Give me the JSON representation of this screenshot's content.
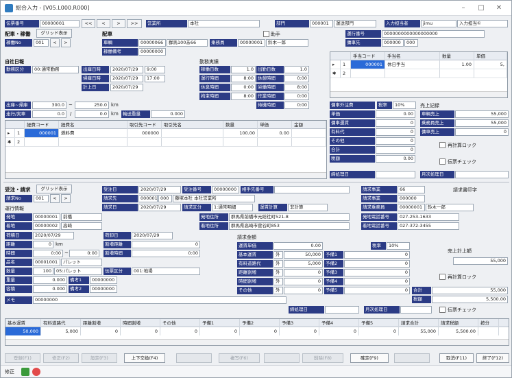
{
  "window": {
    "title": "総合入力 - [V05.L000.R000]",
    "min": "–",
    "max": "□",
    "close": "✕"
  },
  "top": {
    "denpyo_no_label": "伝票番号",
    "denpyo_no": "00000001",
    "nav": [
      "<<",
      "<",
      ">",
      ">>"
    ],
    "eigyosho_label": "営業所",
    "eigyosho_name": "本社",
    "bumon_label": "部門",
    "bumon_code": "000001",
    "bumon_name": "運送部門",
    "tanto_label": "入力担当者",
    "tanto_code": "jimu",
    "tanto_name": "入力担当①"
  },
  "haisha": {
    "title": "配車・稼働",
    "grid_btn": "グリッド表示",
    "kado_label": "稼働No",
    "kado_no": "001",
    "sharyo_title": "配車",
    "sharyo_label": "車輌",
    "sharyo_code": "00000066",
    "sharyo_name": "群馬100あ66",
    "jomu_label": "乗務員",
    "jomu_code": "00000001",
    "jomu_name": "鈴木一郎",
    "biko_label": "稼働備考",
    "biko": "00000000",
    "josho_label": "助手",
    "unko_label": "運行番号",
    "unko_no": "0000000000000000000",
    "yosha_label": "傭車先",
    "yosha_code": "000000",
    "yosha_code2": "000"
  },
  "teate": {
    "headers": [
      "手当コード",
      "手当名",
      "数量",
      "単価"
    ],
    "rows": [
      {
        "mark": "▸",
        "no": "1",
        "code": "000001",
        "name": "休日手当",
        "qty": "1.00",
        "price": "5,"
      },
      {
        "mark": "✱",
        "no": "2",
        "code": "",
        "name": "",
        "qty": "",
        "price": ""
      }
    ]
  },
  "nippo": {
    "title": "自社日報",
    "kubun_label": "勤務区分",
    "kubun": "00:通常勤務",
    "shukko_label": "出庫日時",
    "shukko_date": "2020/07/29",
    "shukko_time": "9:00",
    "kiko_label": "帰庫日時",
    "kiko_date": "2020/07/29",
    "kiko_time": "17:00",
    "keijo_label": "計上日",
    "keijo_date": "2020/07/29",
    "kinmu_title": "勤務実績",
    "rows": [
      {
        "l1": "稼働日数",
        "v1": "1.0",
        "l2": "出勤日数",
        "v2": "1.0"
      },
      {
        "l1": "運行時間",
        "v1": "8:00",
        "l2": "休憩時間",
        "v2": "0:00"
      },
      {
        "l1": "休息時間",
        "v1": "0:00",
        "l2": "労働時間",
        "v2": "8:00"
      },
      {
        "l1": "拘束時間",
        "v1": "8:00",
        "l2": "作業時間",
        "v2": "0:00"
      },
      {
        "l1": "",
        "v1": "",
        "l2": "待機時間",
        "v2": "0:00"
      }
    ],
    "meter_label": "出庫~帰庫",
    "meter_from": "300.0",
    "meter_to": "250.0",
    "meter_unit": "km",
    "sokou_label": "走行/実車",
    "sokou": "0.0",
    "jissha": "0.0",
    "jissha_unit": "km",
    "yuso_label": "輸送重量",
    "yuso": "0.000"
  },
  "keihi": {
    "headers": [
      "経費コード",
      "経費名",
      "取引先コード",
      "取引先名",
      "数量",
      "単価",
      "金額"
    ],
    "rows": [
      {
        "mark": "▸",
        "no": "1",
        "code": "000001",
        "name": "燃料費",
        "tcode": "000000",
        "tname": "",
        "qty": "100.00",
        "price": "0.00",
        "amt": ""
      },
      {
        "mark": "✱",
        "no": "2",
        "code": "",
        "name": "",
        "tcode": "",
        "tname": "",
        "qty": "",
        "price": "",
        "amt": ""
      }
    ]
  },
  "shain": {
    "label": "傭車外注費",
    "zei_label": "税率",
    "zei": "10%",
    "uriage_label": "売上記録",
    "rows": [
      {
        "l": "単価",
        "v": "0.00"
      },
      {
        "l": "傭車運賃",
        "v": "0"
      },
      {
        "l": "有料代",
        "v": "0"
      },
      {
        "l": "その他",
        "v": "0"
      },
      {
        "l": "合計",
        "v": "0"
      },
      {
        "l": "税額",
        "v": "0.00"
      }
    ],
    "urows": [
      {
        "l": "車輌売上",
        "v": "55,000"
      },
      {
        "l": "乗務員売上",
        "v": "55,000"
      },
      {
        "l": "傭車売上",
        "v": "0"
      }
    ],
    "saikei": "再計算ロック",
    "denpyo_check": "伝票チェック",
    "shime_label": "締処理日",
    "getsuji_label": "月次処理日"
  },
  "juchu": {
    "title": "受注・請求",
    "grid_btn": "グリッド表示",
    "seikyu_no_label": "請求No",
    "seikyu_no": "001",
    "juchu_date_label": "受注日",
    "juchu_date": "2020/07/29",
    "juchu_no_label": "受注番号",
    "juchu_no": "00000000",
    "aite_label": "相手先番号",
    "seikyusaki_label": "請求先",
    "seikyusaki_code": "000001",
    "seikyusaki_sub": "000",
    "seikyusaki_name": "藤塚本社 本社営業所",
    "seikyu_date_label": "請求日",
    "seikyu_date": "2020/07/29",
    "seikyu_kubun_label": "請求区分",
    "seikyu_kubun": "1:通常明細",
    "unchin_label": "運賃計算",
    "unchin": "非計算",
    "jigyo_label": "請求事業",
    "jigyo": "66",
    "jigyosho_label": "請求事業",
    "jigyosho": "000000",
    "seikyu_tanto_label": "請求乗務員",
    "seikyu_tanto_code": "00000001",
    "seikyu_tanto_name": "鈴木一郎",
    "insatsu": "請求書印字",
    "unko_title": "運行情報",
    "hatsuchi_label": "発地",
    "hatsuchi_code": "00000001",
    "hatsuchi_name": "前橋",
    "chakuchi_label": "着地",
    "chakuchi_code": "00000002",
    "chakuchi_name": "高崎",
    "hatsu_addr_label": "発地住所",
    "hatsu_addr": "群馬県前橋市元総社町521-8",
    "chaku_addr_label": "着地住所",
    "chaku_addr": "群馬県高崎市菅谷町853",
    "hatsu_tel_label": "発地電話番号",
    "hatsu_tel": "027-253-1633",
    "chaku_tel_label": "着地電話番号",
    "chaku_tel": "027-372-3455",
    "nizumi_label": "荷積日",
    "nizumi": "2020/07/29",
    "nioroshi_label": "荷卸日",
    "nioroshi": "2020/07/29",
    "kyori_label": "距離",
    "kyori": "0",
    "kyori_unit": "km",
    "warimashi_kyori_label": "割増距離",
    "warimashi_kyori": "0",
    "jikan_label": "時間",
    "jikan_from": "0:00",
    "jikan_to": "0:00",
    "warimashi_jikan_label": "割増時間",
    "warimashi_jikan": "0:00",
    "hinmei_label": "品名",
    "hinmei_code": "00001001",
    "hinmei": "パレット",
    "suryo_label": "数量",
    "suryo": "100",
    "tani": "05:パレット",
    "denpyo_kubun_label": "伝票区分",
    "denpyo_kubun": "001:地場",
    "juryo_label": "重量",
    "juryo": "0.000",
    "biko1_label": "備考1",
    "biko1": "00000000",
    "yoseki_label": "容積",
    "yoseki": "0.000",
    "biko2_label": "備考2",
    "biko2": "00000000",
    "memo_label": "メモ",
    "memo": "00000000"
  },
  "kingaku": {
    "title": "請求金額",
    "tanka_label": "運賃単価",
    "tanka": "0.00",
    "zei_label": "税率",
    "zei": "10%",
    "rows": [
      {
        "l": "基本運賃",
        "f": "外",
        "v": "50,000",
        "y": "予備1"
      },
      {
        "l": "有料道路代",
        "f": "外",
        "v": "5,000",
        "y": "予備2"
      },
      {
        "l": "距離割増",
        "f": "外",
        "v": "0",
        "y": "予備3"
      },
      {
        "l": "時間割増",
        "f": "外",
        "v": "0",
        "y": "予備4"
      },
      {
        "l": "その他",
        "f": "外",
        "v": "0",
        "y": "予備5"
      }
    ],
    "yobi_vals": [
      "0",
      "0",
      "0",
      "0",
      "0"
    ],
    "gokei_label": "合計",
    "gokei": "55,000",
    "zeigaku_label": "税額",
    "zeigaku": "5,500.00",
    "uriage_label": "売上計上額",
    "uriage": "55,000",
    "saikei": "再計算ロック",
    "shime_label": "締処理日",
    "getsuji_label": "月次処理日",
    "denpyo_check": "伝票チェック"
  },
  "summary": {
    "headers": [
      "基本運賃",
      "有料道路代",
      "距離割増",
      "時間割増",
      "その他",
      "予備1",
      "予備2",
      "予備3",
      "予備4",
      "予備5",
      "請求合計",
      "請求税額",
      "按分"
    ],
    "values": [
      "50,000",
      "5,000",
      "0",
      "0",
      "0",
      "0",
      "0",
      "0",
      "0",
      "0",
      "55,000",
      "5,500.00",
      ""
    ]
  },
  "fbar": [
    {
      "label": "登録(F1)",
      "on": false
    },
    {
      "label": "修正(F2)",
      "on": false
    },
    {
      "label": "設定(F3)",
      "on": false
    },
    {
      "label": "上下交換(F4)",
      "on": true
    },
    {
      "label": "",
      "on": false
    },
    {
      "label": "複写(F6)",
      "on": false
    },
    {
      "label": "",
      "on": false
    },
    {
      "label": "削除(F8)",
      "on": false
    },
    {
      "label": "確定(F9)",
      "on": true
    },
    {
      "label": "",
      "on": false
    },
    {
      "label": "取消(F11)",
      "on": true
    },
    {
      "label": "終了(F12)",
      "on": true
    }
  ],
  "status": {
    "mode": "修正"
  }
}
